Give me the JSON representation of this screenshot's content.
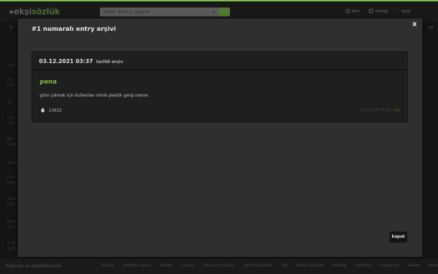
{
  "header": {
    "logo_part1": "ekşi",
    "logo_part2": "sözlük",
    "search_placeholder": "başlık, #entry, @yazar",
    "nav": [
      {
        "label": "ben",
        "icon": "user-icon"
      },
      {
        "label": "mesaj",
        "icon": "message-icon"
      },
      {
        "label": "ayar",
        "icon": "menu-icon"
      }
    ]
  },
  "background": {
    "left_letter": "b",
    "right_letter": "ar"
  },
  "modal": {
    "title": "#1 numaralı entry arşivi",
    "close_label": "x",
    "card": {
      "date": "03.12.2021 03:37",
      "date_suffix": "tarihli arşiv",
      "entry_title": "pena",
      "entry_text": "gitar çalmak için kullanılan minik plastik garip nesne.",
      "fav_count": "13632",
      "meta": "15.02.1999 ssg",
      "meta_link": "ssg"
    },
    "kapat_label": "kapat"
  },
  "footer": {
    "left": "bugünün en popülerlerinde",
    "links": [
      "iletişim",
      "şeffaflık raporu",
      "reklam",
      "kariyer",
      "kullanım koşulları",
      "gizlilik politikası",
      "faq",
      "sözlük kuralları",
      "modlog",
      "sub-etha",
      "instagram",
      "twitter",
      "facebook"
    ]
  },
  "colors": {
    "accent": "#81c14b",
    "modal_bg": "#2f2f2f",
    "card_bg": "#1f1f1f"
  }
}
